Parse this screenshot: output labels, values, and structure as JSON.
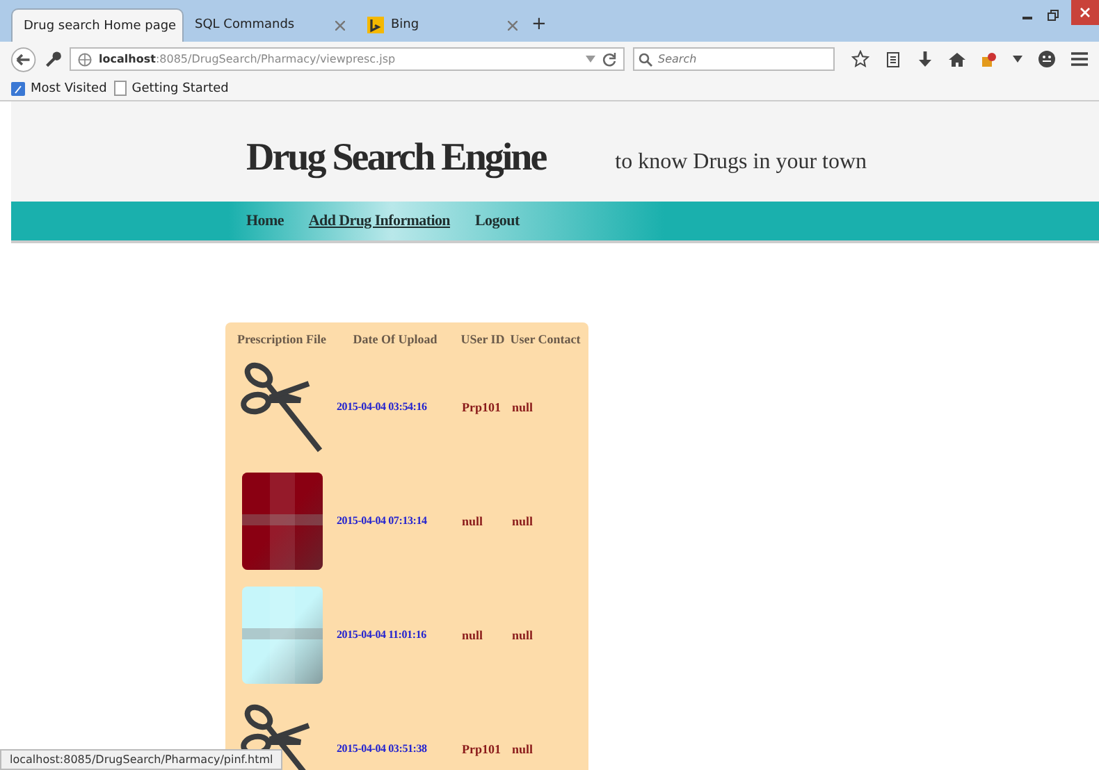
{
  "browser": {
    "tabs": [
      {
        "label": "Drug search Home page",
        "selected": true,
        "kind": "plain"
      },
      {
        "label": "SQL Commands",
        "selected": false,
        "kind": "plain"
      },
      {
        "label": "Bing",
        "selected": false,
        "kind": "favicon"
      }
    ],
    "new_tab": "+",
    "address": {
      "host": "localhost",
      "path": ":8085/DrugSearch/Pharmacy/viewpresc.jsp"
    },
    "search": {
      "placeholder": "Search"
    },
    "bookmarks": [
      "Most Visited",
      "Getting Started"
    ],
    "status": "localhost:8085/DrugSearch/Pharmacy/pinf.html"
  },
  "site": {
    "title": "Drug Search Engine",
    "tagline": "to know Drugs in your town",
    "nav": [
      {
        "label": "Home",
        "selected": false
      },
      {
        "label": "Add Drug Information",
        "selected": true
      },
      {
        "label": "Logout",
        "selected": false
      }
    ]
  },
  "table": {
    "columns": [
      "Prescription File",
      "Date Of Upload",
      "USer ID",
      "User Contact"
    ],
    "rows": [
      {
        "file": {
          "kind": "scissors"
        },
        "date": "2015-04-04 03:54:16",
        "user_id": "Prp101",
        "contact": "null"
      },
      {
        "file": {
          "kind": "swatch",
          "color": "#8a0012"
        },
        "date": "2015-04-04 07:13:14",
        "user_id": "null",
        "contact": "null"
      },
      {
        "file": {
          "kind": "swatch",
          "color": "#c6f6fa"
        },
        "date": "2015-04-04 11:01:16",
        "user_id": "null",
        "contact": "null"
      },
      {
        "file": {
          "kind": "scissors"
        },
        "date": "2015-04-04 03:51:38",
        "user_id": "Prp101",
        "contact": "null"
      }
    ]
  }
}
